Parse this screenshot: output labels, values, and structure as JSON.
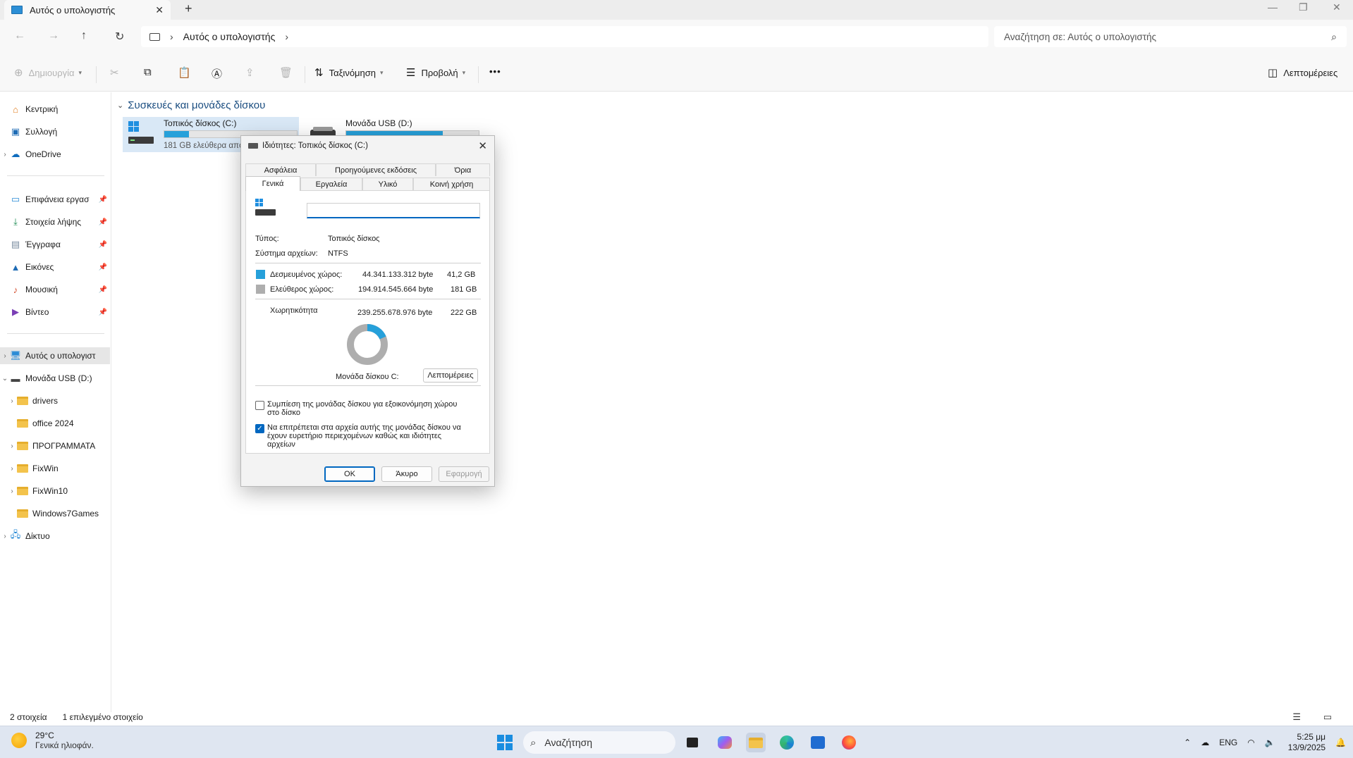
{
  "window": {
    "tab_title": "Αυτός ο υπολογιστής",
    "close_tab_glyph": "✕",
    "new_tab_glyph": "+"
  },
  "nav": {
    "breadcrumb": "Αυτός ο υπολογιστής",
    "search_placeholder": "Αναζήτηση σε: Αυτός ο υπολογιστής"
  },
  "toolbar": {
    "new_label": "Δημιουργία",
    "sort_label": "Ταξινόμηση",
    "view_label": "Προβολή",
    "more_label": "•••",
    "details_label": "Λεπτομέρειες"
  },
  "sidebar": {
    "items": [
      {
        "label": "Κεντρική",
        "icon": "home-icon"
      },
      {
        "label": "Συλλογή",
        "icon": "gallery-icon"
      },
      {
        "label": "OneDrive",
        "icon": "cloud-icon"
      },
      {
        "label": "Επιφάνεια εργασ",
        "icon": "desktop-icon"
      },
      {
        "label": "Στοιχεία λήψης",
        "icon": "download-icon"
      },
      {
        "label": "Έγγραφα",
        "icon": "documents-icon"
      },
      {
        "label": "Εικόνες",
        "icon": "pictures-icon"
      },
      {
        "label": "Μουσική",
        "icon": "music-icon"
      },
      {
        "label": "Βίντεο",
        "icon": "video-icon"
      },
      {
        "label": "Αυτός ο υπολογιστ",
        "icon": "pc-icon"
      },
      {
        "label": "Μονάδα USB (D:)",
        "icon": "usb-drive-icon"
      },
      {
        "label": "drivers",
        "icon": "folder-icon"
      },
      {
        "label": "office 2024",
        "icon": "folder-icon"
      },
      {
        "label": "ΠΡΟΓΡΑΜΜΑΤΑ",
        "icon": "folder-icon"
      },
      {
        "label": "FixWin",
        "icon": "folder-icon"
      },
      {
        "label": "FixWin10",
        "icon": "folder-icon"
      },
      {
        "label": "Windows7Games",
        "icon": "folder-icon"
      },
      {
        "label": "Δίκτυο",
        "icon": "network-icon"
      }
    ]
  },
  "content": {
    "group_title": "Συσκευές και μονάδες δίσκου",
    "drives": [
      {
        "name": "Τοπικός δίσκος (C:)",
        "free_text": "181 GB ελεύθερα από 222 GB",
        "used_fraction": 0.186
      },
      {
        "name": "Μονάδα USB (D:)",
        "free_text": "",
        "used_fraction": 0.73
      }
    ]
  },
  "status": {
    "items_count": "2 στοιχεία",
    "selected_count": "1 επιλεγμένο στοιχείο"
  },
  "dialog": {
    "title": "Ιδιότητες: Τοπικός δίσκος (C:)",
    "tabs_row1": [
      "Ασφάλεια",
      "Προηγούμενες εκδόσεις",
      "Όρια"
    ],
    "tabs_row2": [
      "Γενικά",
      "Εργαλεία",
      "Υλικό",
      "Κοινή χρήση"
    ],
    "volume_name": "",
    "type_label": "Τύπος:",
    "type_value": "Τοπικός δίσκος",
    "fs_label": "Σύστημα αρχείων:",
    "fs_value": "NTFS",
    "used_label": "Δεσμευμένος χώρος:",
    "used_bytes": "44.341.133.312 byte",
    "used_size": "41,2 GB",
    "free_label": "Ελεύθερος χώρος:",
    "free_bytes": "194.914.545.664 byte",
    "free_size": "181 GB",
    "capacity_label": "Χωρητικότητα",
    "capacity_bytes": "239.255.678.976 byte",
    "capacity_size": "222 GB",
    "used_fraction": 0.185,
    "drive_label": "Μονάδα δίσκου C:",
    "details_button": "Λεπτομέρειες",
    "compress_label_1": "Συμπίεση της μονάδας δίσκου για εξοικονόμηση χώρου",
    "compress_label_2": "στο δίσκο",
    "index_label_1": "Να επιτρέπεται στα αρχεία αυτής της μονάδας δίσκου να",
    "index_label_2": "έχουν ευρετήριο περιεχομένων καθώς και ιδιότητες",
    "index_label_3": "αρχείων",
    "compress_checked": false,
    "index_checked": true,
    "ok_label": "OK",
    "cancel_label": "Άκυρο",
    "apply_label": "Εφαρμογή",
    "used_color": "#26a0da",
    "free_color": "#aeaeae"
  },
  "taskbar": {
    "temp": "29°C",
    "weather": "Γενικά ηλιοφάν.",
    "search_label": "Αναζήτηση",
    "lang": "ENG",
    "time": "5:25 μμ",
    "date": "13/9/2025"
  }
}
